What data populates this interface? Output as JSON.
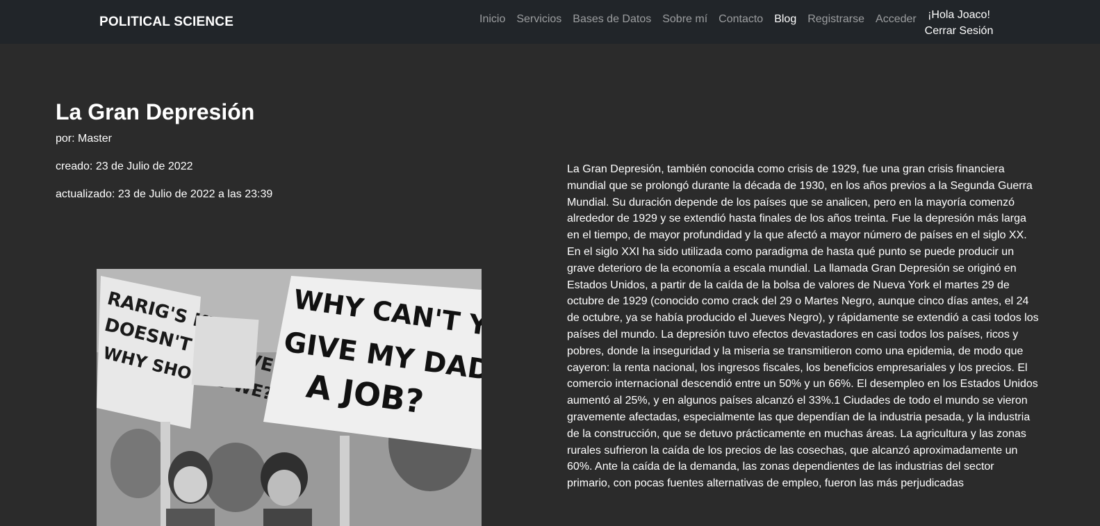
{
  "navbar": {
    "brand": "POLITICAL SCIENCE",
    "links": [
      {
        "label": "Inicio",
        "active": false
      },
      {
        "label": "Servicios",
        "active": false
      },
      {
        "label": "Bases de Datos",
        "active": false
      },
      {
        "label": "Sobre mí",
        "active": false
      },
      {
        "label": "Contacto",
        "active": false
      },
      {
        "label": "Blog",
        "active": true
      },
      {
        "label": "Registrarse",
        "active": false
      },
      {
        "label": "Acceder",
        "active": false
      }
    ],
    "greeting": "¡Hola Joaco!",
    "logout_label": "Cerrar Sesión"
  },
  "post": {
    "title": "La Gran Depresión",
    "author": "por: Master",
    "created": "creado: 23 de Julio de 2022",
    "updated": "actualizado: 23 de Julio de 2022 a las 23:39",
    "image_sign_text": "WHY CAN'T YOU GIVE MY DAD A JOB?",
    "image_sign_left_text": "RARIG'S KID DOESN'T STARVE WHY SHOULD WE?",
    "body": "La Gran Depresión, también conocida como crisis de 1929, fue una gran crisis financiera mundial que se prolongó durante la década de 1930, en los años previos a la Segunda Guerra Mundial. Su duración depende de los países que se analicen, pero en la mayoría comenzó alrededor de 1929 y se extendió hasta finales de los años treinta. Fue la depresión más larga en el tiempo, de mayor profundidad y la que afectó a mayor número de países en el siglo XX. En el siglo XXI ha sido utilizada como paradigma de hasta qué punto se puede producir un grave deterioro de la economía a escala mundial. La llamada Gran Depresión se originó en Estados Unidos, a partir de la caída de la bolsa de valores de Nueva York el martes 29 de octubre de 1929 (conocido como crack del 29 o Martes Negro, aunque cinco días antes, el 24 de octubre, ya se había producido el Jueves Negro), y rápidamente se extendió a casi todos los países del mundo. La depresión tuvo efectos devastadores en casi todos los países, ricos y pobres, donde la inseguridad y la miseria se transmitieron como una epidemia, de modo que cayeron: la renta nacional, los ingresos fiscales, los beneficios empresariales y los precios. El comercio internacional descendió entre un 50% y un 66%. El desempleo en los Estados Unidos aumentó al 25%, y en algunos países alcanzó el 33%.1 Ciudades de todo el mundo se vieron gravemente afectadas, especialmente las que dependían de la industria pesada, y la industria de la construcción, que se detuvo prácticamente en muchas áreas. La agricultura y las zonas rurales sufrieron la caída de los precios de las cosechas, que alcanzó aproximadamente un 60%. Ante la caída de la demanda, las zonas dependientes de las industrias del sector primario, con pocas fuentes alternativas de empleo, fueron las más perjudicadas"
  }
}
